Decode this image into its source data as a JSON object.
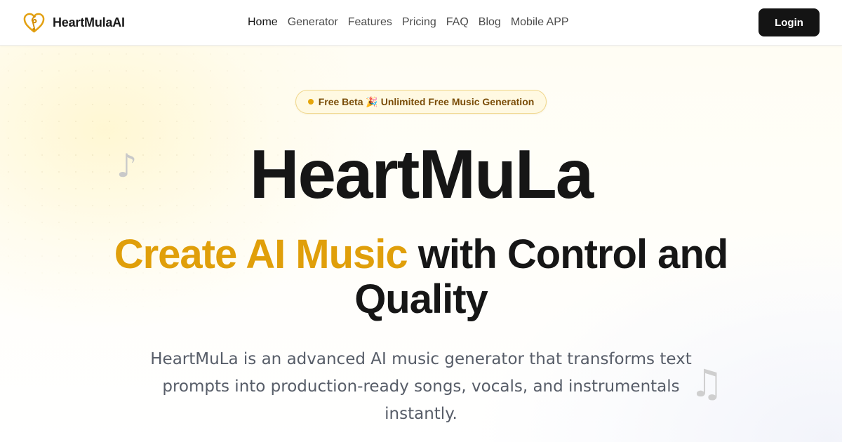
{
  "brand": {
    "name": "HeartMulaAI",
    "logo_icon": "treble-clef-heart-icon",
    "accent_color": "#e09f0a"
  },
  "nav": {
    "items": [
      {
        "label": "Home",
        "active": true
      },
      {
        "label": "Generator",
        "active": false
      },
      {
        "label": "Features",
        "active": false
      },
      {
        "label": "Pricing",
        "active": false
      },
      {
        "label": "FAQ",
        "active": false
      },
      {
        "label": "Blog",
        "active": false
      },
      {
        "label": "Mobile APP",
        "active": false
      }
    ]
  },
  "header": {
    "login_label": "Login"
  },
  "hero": {
    "badge": "Free Beta 🎉 Unlimited Free Music Generation",
    "title": "HeartMuLa",
    "subtitle_accent": "Create AI Music",
    "subtitle_rest": "with Control and Quality",
    "description": "HeartMuLa is an advanced AI music generator that transforms text prompts into production-ready songs, vocals, and instrumentals instantly.",
    "note_left": "♪",
    "note_right": "♫"
  },
  "colors": {
    "badge_border": "#f0d68a",
    "badge_bg": "#fff9e2",
    "badge_text": "#7a4d08",
    "login_bg": "#141414"
  }
}
